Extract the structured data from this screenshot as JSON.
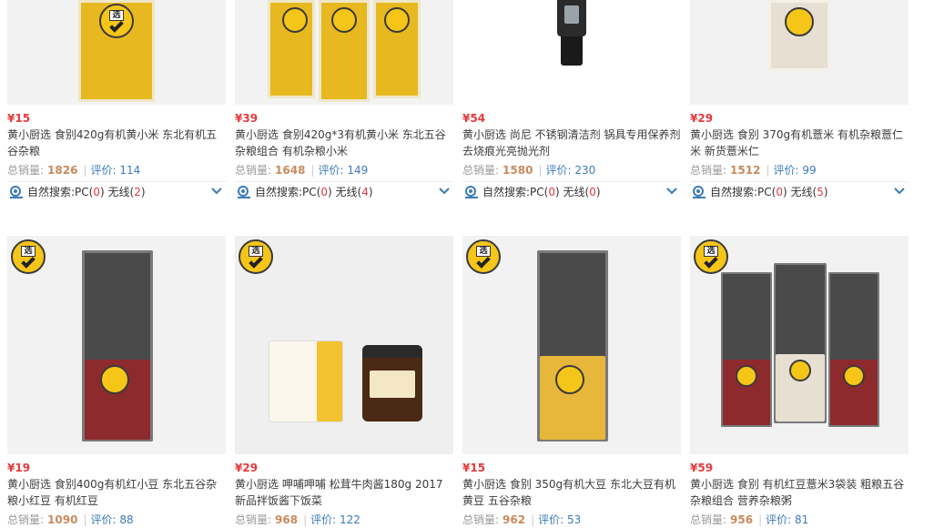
{
  "products": [
    {
      "price": "¥15",
      "title": "黄小厨选 食别420g有机黄小米 东北有机五谷杂粮",
      "sales": "1826",
      "reviews": "114",
      "pc": "0",
      "wx": "2"
    },
    {
      "price": "¥39",
      "title": "黄小厨选 食别420g*3有机黄小米 东北五谷杂粮组合 有机杂粮小米",
      "sales": "1648",
      "reviews": "149",
      "pc": "0",
      "wx": "4"
    },
    {
      "price": "¥54",
      "title": "黄小厨选 尚尼 不锈钢清洁剂 锅具专用保养剂 去烧痕光亮抛光剂",
      "sales": "1580",
      "reviews": "230",
      "pc": "0",
      "wx": "0"
    },
    {
      "price": "¥29",
      "title": "黄小厨选 食别 370g有机薏米 有机杂粮薏仁米 新货薏米仁",
      "sales": "1512",
      "reviews": "99",
      "pc": "0",
      "wx": "5"
    },
    {
      "price": "¥19",
      "title": "黄小厨选 食别400g有机红小豆 东北五谷杂粮小红豆 有机红豆",
      "sales": "1090",
      "reviews": "88"
    },
    {
      "price": "¥29",
      "title": "黄小厨选 呷哺呷哺 松茸牛肉酱180g 2017新品拌饭酱下饭菜",
      "sales": "968",
      "reviews": "122"
    },
    {
      "price": "¥15",
      "title": "黄小厨选 食别 350g有机大豆 东北大豆有机黄豆 五谷杂粮",
      "sales": "962",
      "reviews": "53"
    },
    {
      "price": "¥59",
      "title": "黄小厨选 食别 有机红豆薏米3袋装 粗粮五谷杂粮组合 营养杂粮粥",
      "sales": "956",
      "reviews": "81"
    }
  ],
  "labels": {
    "sales": "总销量:",
    "reviews": "评价:",
    "search": "自然搜索:",
    "pc": "PC",
    "wx": "无线",
    "badge": "选"
  },
  "icons": {
    "search": "snail-search-icon",
    "expand": "chevron-down-icon"
  },
  "colors": {
    "price": "#e4393c",
    "sales": "#c88a5c",
    "link": "#3b7ab8"
  }
}
